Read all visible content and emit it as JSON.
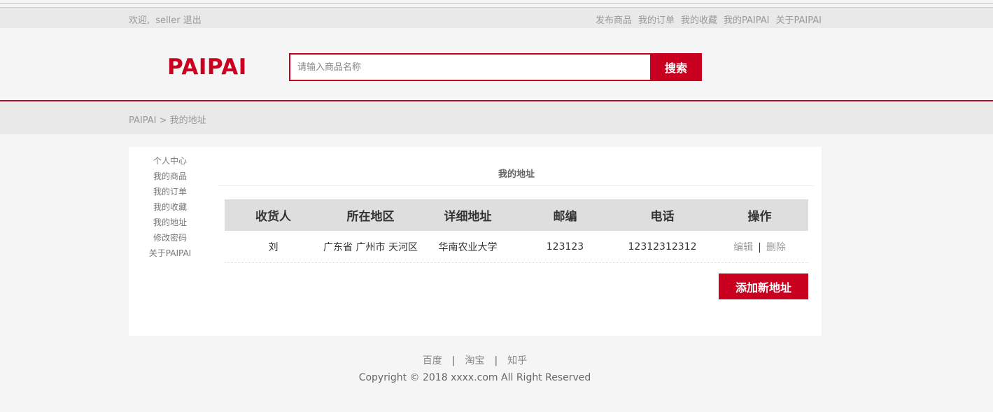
{
  "topbar": {
    "welcome": "欢迎,",
    "username": "seller",
    "logout": "退出",
    "nav": [
      "发布商品",
      "我的订单",
      "我的收藏",
      "我的PAIPAI",
      "关于PAIPAI"
    ]
  },
  "header": {
    "logo": "PAIPAI",
    "search_placeholder": "请输入商品名称",
    "search_button": "搜索"
  },
  "breadcrumb": "PAIPAI > 我的地址",
  "sidebar": {
    "items": [
      "个人中心",
      "我的商品",
      "我的订单",
      "我的收藏",
      "我的地址",
      "修改密码",
      "关于PAIPAI"
    ]
  },
  "main": {
    "title": "我的地址",
    "columns": [
      "收货人",
      "所在地区",
      "详细地址",
      "邮编",
      "电话",
      "操作"
    ],
    "rows": [
      {
        "name": "刘",
        "region": "广东省 广州市 天河区",
        "address": "华南农业大学",
        "zip": "123123",
        "phone": "12312312312",
        "edit": "编辑",
        "sep": "|",
        "delete": "删除"
      }
    ],
    "add_button": "添加新地址"
  },
  "footer": {
    "links": [
      "百度",
      "淘宝",
      "知乎"
    ],
    "separator": "|",
    "copyright": "Copyright © 2018 xxxx.com All Right Reserved"
  },
  "colors": {
    "brand": "#c9001f",
    "page_bg": "#f5f5f5",
    "bar_bg": "#e9e9e9"
  }
}
